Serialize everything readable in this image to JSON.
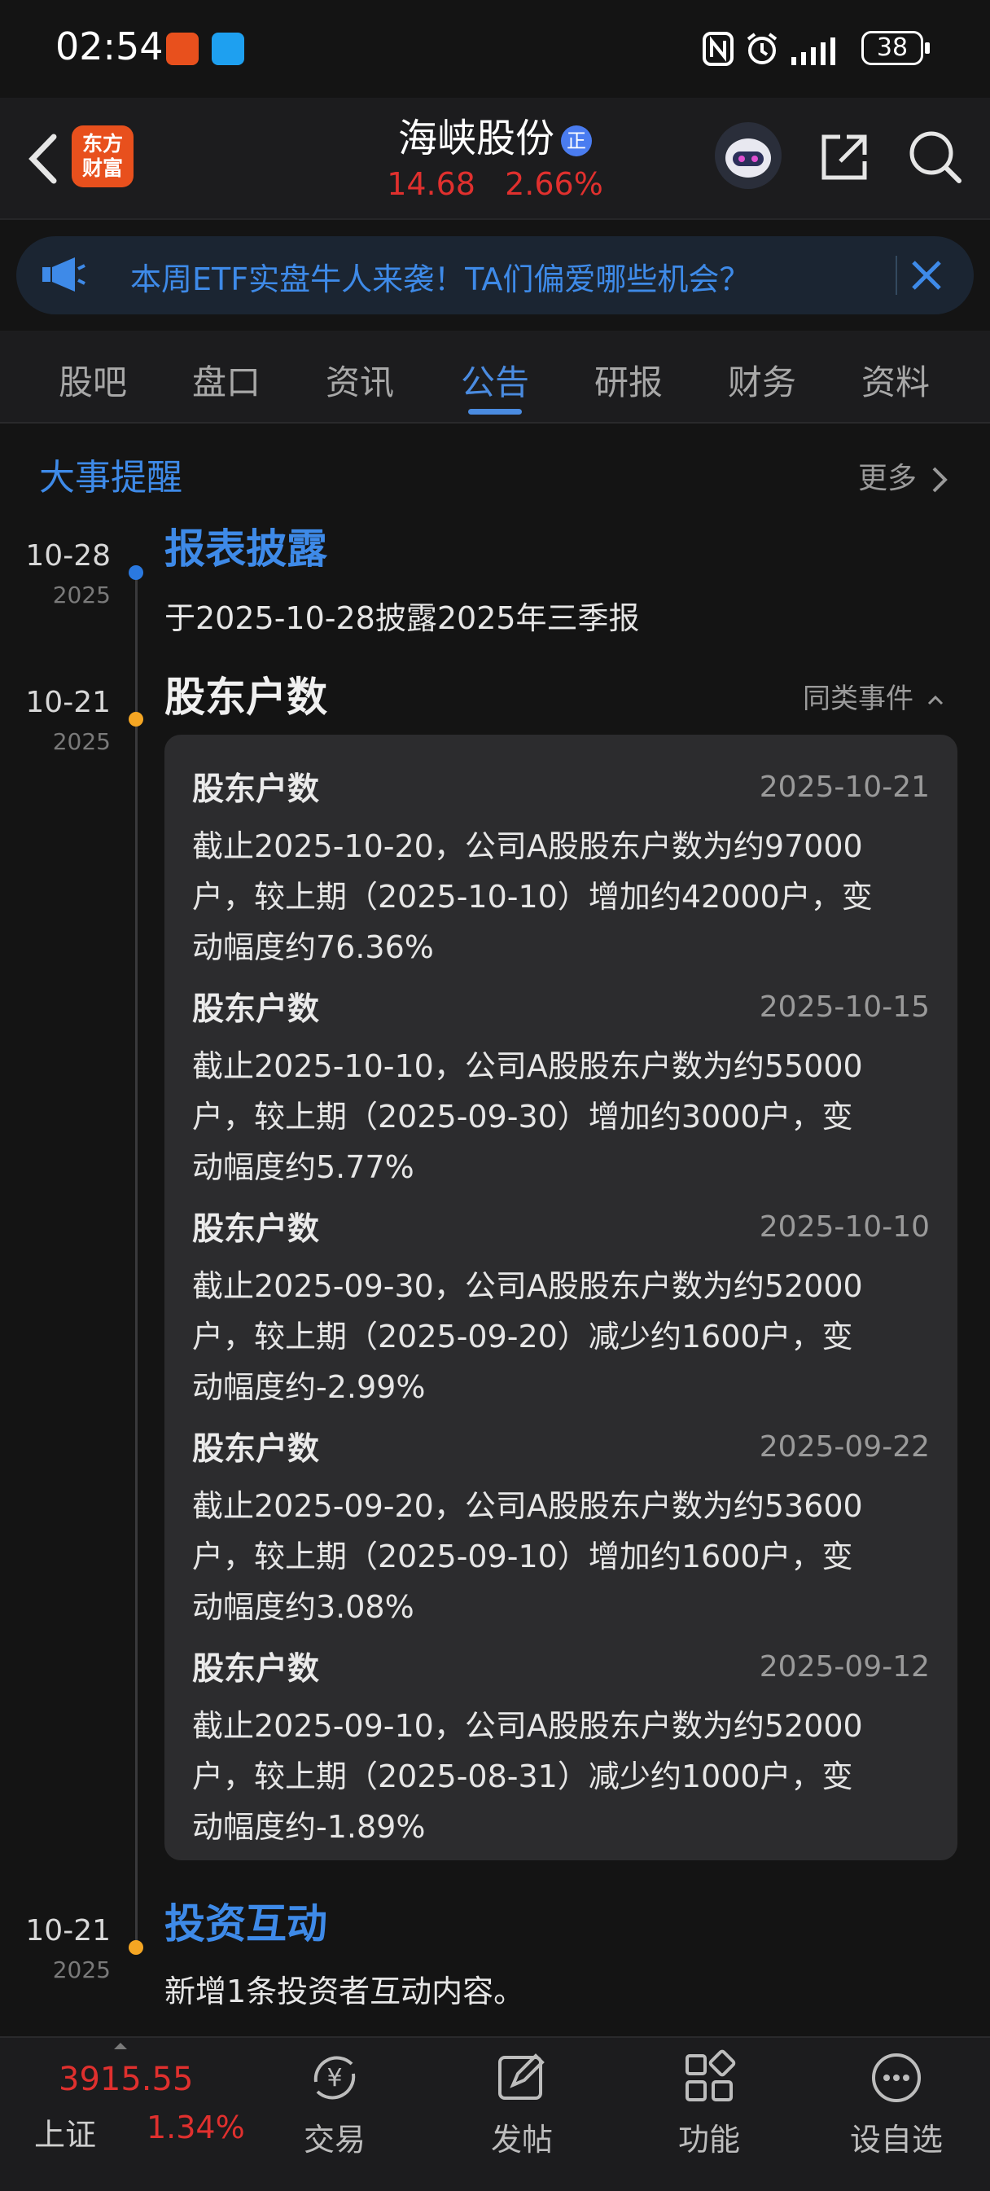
{
  "status_bar": {
    "time": "02:54",
    "battery": "38"
  },
  "header": {
    "back_icon": "chevron-left-icon",
    "app_logo": [
      "东方",
      "财富"
    ],
    "stock_name": "海峡股份",
    "badge": "正",
    "price": "14.68",
    "change_pct": "2.66%",
    "price_color": "#e0302e"
  },
  "banner": {
    "text": "本周ETF实盘牛人来袭！TA们偏爱哪些机会？"
  },
  "tabs": [
    "股吧",
    "盘口",
    "资讯",
    "公告",
    "研报",
    "财务",
    "资料"
  ],
  "active_tab": "公告",
  "section": {
    "title": "大事提醒",
    "more": "更多"
  },
  "events": [
    {
      "md": "10-28",
      "year": "2025",
      "title": "报表披露",
      "desc": "于2025-10-28披露2025年三季报"
    },
    {
      "md": "10-21",
      "year": "2025",
      "title": "股东户数",
      "similar": "同类事件"
    },
    {
      "md": "10-21",
      "year": "2025",
      "title": "投资互动",
      "desc": "新增1条投资者互动内容。"
    }
  ],
  "records": [
    {
      "title": "股东户数",
      "date": "2025-10-21",
      "lines": [
        "截止2025-10-20，公司A股股东户数为约97000",
        "户，较上期（2025-10-10）增加约42000户，变",
        "动幅度约76.36%"
      ]
    },
    {
      "title": "股东户数",
      "date": "2025-10-15",
      "lines": [
        "截止2025-10-10，公司A股股东户数为约55000",
        "户，较上期（2025-09-30）增加约3000户，变",
        "动幅度约5.77%"
      ]
    },
    {
      "title": "股东户数",
      "date": "2025-10-10",
      "lines": [
        "截止2025-09-30，公司A股股东户数为约52000",
        "户，较上期（2025-09-20）减少约1600户，变",
        "动幅度约-2.99%"
      ]
    },
    {
      "title": "股东户数",
      "date": "2025-09-22",
      "lines": [
        "截止2025-09-20，公司A股股东户数为约53600",
        "户，较上期（2025-09-10）增加约1600户，变",
        "动幅度约3.08%"
      ]
    },
    {
      "title": "股东户数",
      "date": "2025-09-12",
      "lines": [
        "截止2025-09-10，公司A股股东户数为约52000",
        "户，较上期（2025-08-31）减少约1000户，变",
        "动幅度约-1.89%"
      ]
    }
  ],
  "bottom_nav": {
    "index_value": "3915.55",
    "index_name": "上证",
    "index_pct": "1.34%",
    "items": [
      {
        "label": "交易",
        "icon": "yen-exchange-icon"
      },
      {
        "label": "发帖",
        "icon": "edit-post-icon"
      },
      {
        "label": "功能",
        "icon": "grid-apps-icon"
      },
      {
        "label": "设自选",
        "icon": "more-dots-icon"
      }
    ]
  },
  "colors": {
    "accent_blue": "#3e8ae8",
    "up_red": "#e0302e",
    "dot_blue": "#2a79e0",
    "dot_orange": "#f5a623"
  }
}
